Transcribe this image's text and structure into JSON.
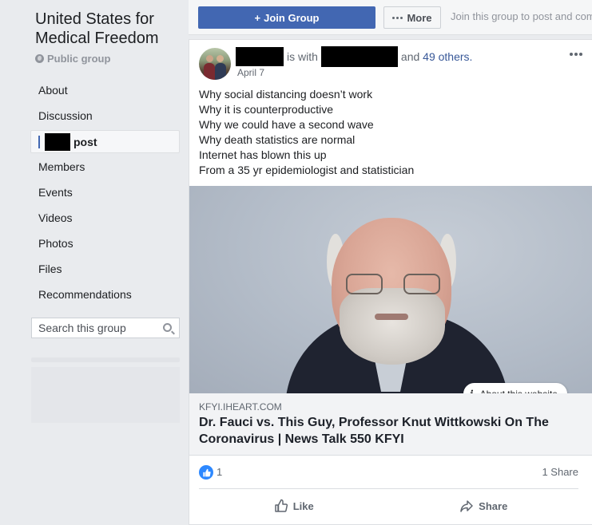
{
  "sidebar": {
    "group_name": "United States for Medical Freedom",
    "privacy": "Public group",
    "nav": [
      "About",
      "Discussion",
      "post",
      "Members",
      "Events",
      "Videos",
      "Photos",
      "Files",
      "Recommendations"
    ],
    "search_placeholder": "Search this group"
  },
  "topbar": {
    "join_label": "Join Group",
    "more_label": "More",
    "join_hint": "Join this group to post and comment."
  },
  "post": {
    "with_text": "is with",
    "and_text": "and",
    "others_link": "49 others.",
    "date": "April 7",
    "lines": [
      "Why social distancing doesn’t work",
      "Why it is counterproductive",
      "Why we could have a second wave",
      "Why death statistics are normal",
      "Internet has blown this up",
      "From a 35 yr epidemiologist and statistician"
    ],
    "about_site": "About this website",
    "link": {
      "domain": "KFYI.IHEART.COM",
      "headline": "Dr. Fauci vs. This Guy, Professor Knut Wittkowski On The Coronavirus | News Talk 550 KFYI"
    },
    "like_count": "1",
    "share_count": "1 Share",
    "like_label": "Like",
    "share_label": "Share"
  },
  "colors": {
    "accent": "#4267b2",
    "link": "#385898",
    "reaction_blue": "#2d88ff",
    "background": "#e9ebee"
  },
  "icons": [
    "globe-icon",
    "plus-icon",
    "more-dots-icon",
    "search-icon",
    "menu-dots-icon",
    "info-icon",
    "like-reaction-icon",
    "like-icon",
    "share-icon"
  ]
}
